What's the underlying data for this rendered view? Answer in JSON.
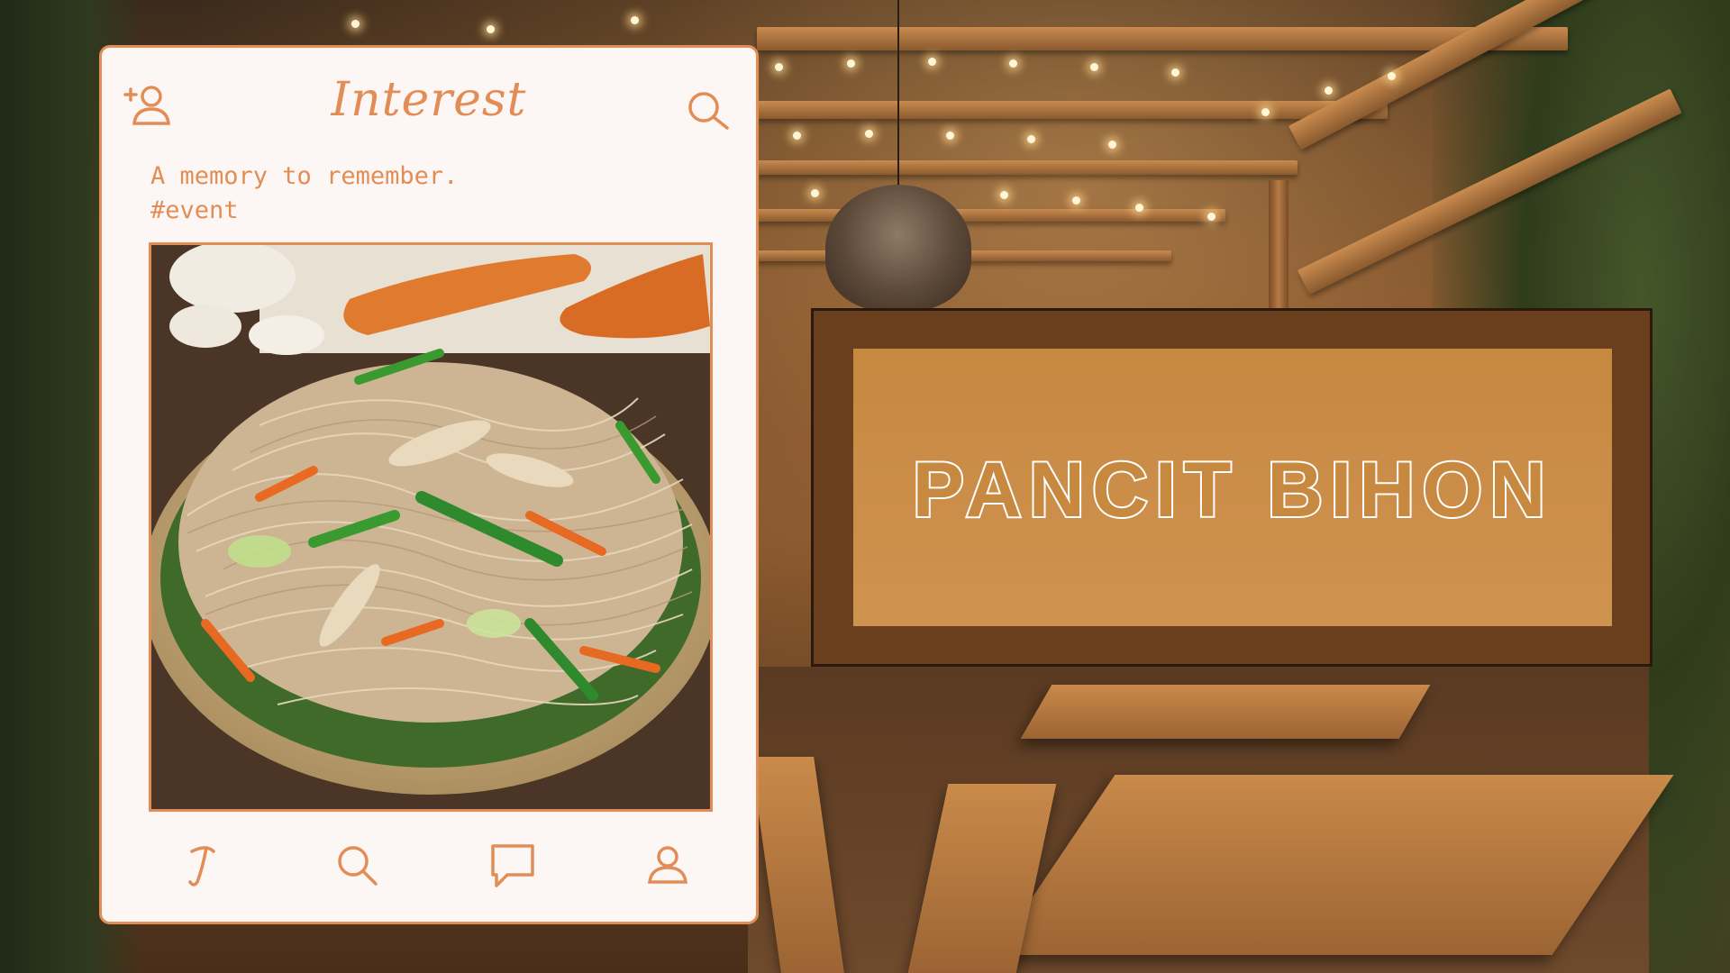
{
  "app": {
    "title": "Interest",
    "caption_line1": "A memory to remember.",
    "caption_line2": "#event",
    "accent_color": "#e38d56",
    "card_background": "#fcf7f5"
  },
  "header_icons": [
    "add-user-icon",
    "search-icon"
  ],
  "photo": {
    "subject": "pancit-bihon-noodle-dish"
  },
  "bottom_nav": {
    "items": [
      {
        "icon": "home-logo-icon"
      },
      {
        "icon": "search-icon"
      },
      {
        "icon": "chat-icon"
      },
      {
        "icon": "profile-icon"
      }
    ]
  },
  "banner": {
    "title": "PANCIT BIHON",
    "outer_color": "#6a3f1e",
    "inner_color": "#c78840",
    "text_color": "#ffffff"
  }
}
